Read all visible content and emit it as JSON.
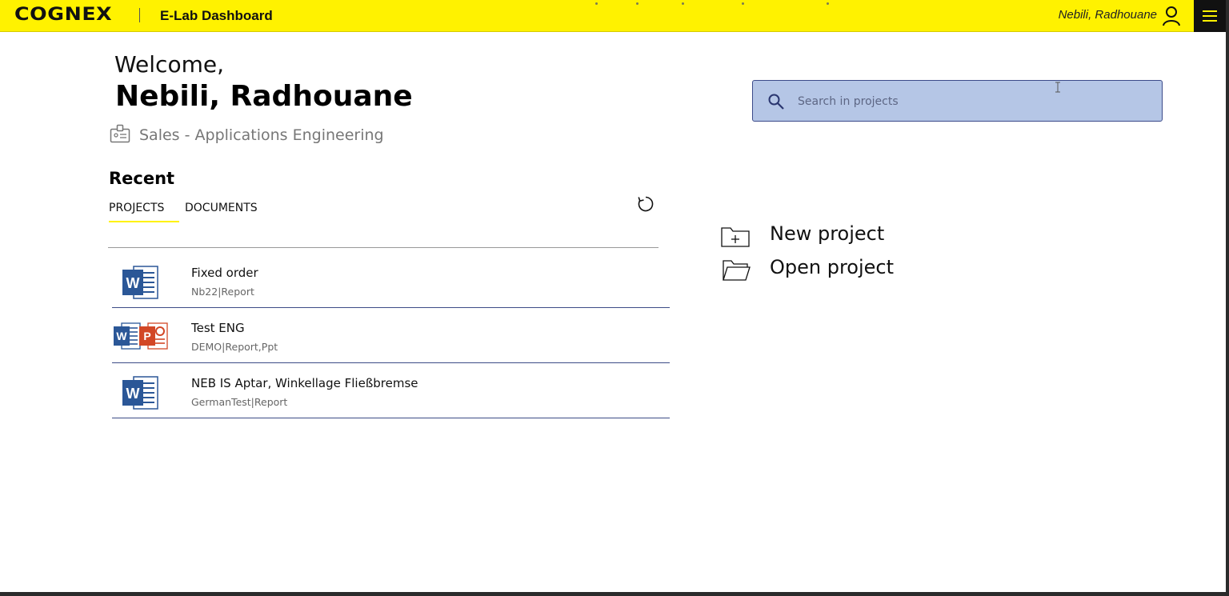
{
  "header": {
    "brand": "COGNEX",
    "app_title": "E-Lab Dashboard",
    "user_name": "Nebili, Radhouane",
    "menu_icon": "hamburger-icon",
    "user_icon": "user-icon"
  },
  "welcome": {
    "greeting": "Welcome,",
    "name": "Nebili, Radhouane",
    "department": "Sales - Applications Engineering"
  },
  "search": {
    "placeholder": "Search in projects",
    "value": ""
  },
  "recent": {
    "title": "Recent",
    "tabs": [
      {
        "label": "PROJECTS",
        "active": true
      },
      {
        "label": "DOCUMENTS",
        "active": false
      }
    ],
    "items": [
      {
        "title": "Fixed order",
        "code": "Nb22",
        "types": "Report",
        "icons": [
          "word-icon"
        ]
      },
      {
        "title": "Test ENG",
        "code": "DEMO",
        "types": "Report,Ppt",
        "icons": [
          "word-icon",
          "powerpoint-icon"
        ]
      },
      {
        "title": "NEB IS Aptar, Winkellage Fließbremse",
        "code": "GermanTest",
        "types": "Report",
        "icons": [
          "word-icon"
        ]
      }
    ]
  },
  "actions": {
    "new_project": "New project",
    "open_project": "Open project"
  },
  "colors": {
    "topbar": "#fff200",
    "search_bg": "#b5c6e6",
    "search_border": "#3b4a8a",
    "word_blue": "#2b5797",
    "ppt_orange": "#d24726"
  }
}
